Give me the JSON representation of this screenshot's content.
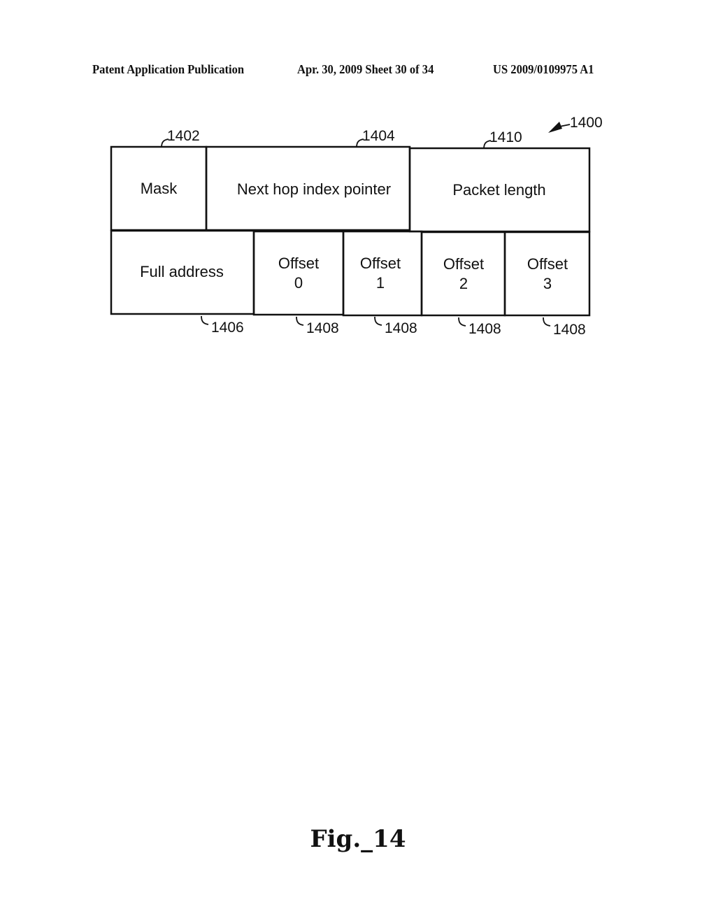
{
  "header": {
    "publication_type": "Patent Application Publication",
    "date_sheet": "Apr. 30, 2009  Sheet 30 of 34",
    "publication_number": "US 2009/0109975 A1"
  },
  "diagram": {
    "figure_reference": "1400",
    "row1": [
      {
        "label": "Mask",
        "ref": "1402"
      },
      {
        "label": "Next hop index pointer",
        "ref": "1404"
      },
      {
        "label": "Packet length",
        "ref": "1410"
      }
    ],
    "row2": [
      {
        "label": "Full address",
        "ref": "1406"
      },
      {
        "label_line1": "Offset",
        "label_line2": "0",
        "ref": "1408"
      },
      {
        "label_line1": "Offset",
        "label_line2": "1",
        "ref": "1408"
      },
      {
        "label_line1": "Offset",
        "label_line2": "2",
        "ref": "1408"
      },
      {
        "label_line1": "Offset",
        "label_line2": "3",
        "ref": "1408"
      }
    ]
  },
  "caption": "Fig._14"
}
